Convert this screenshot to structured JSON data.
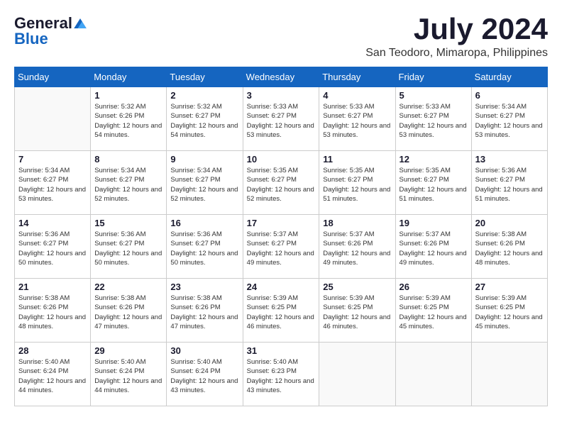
{
  "header": {
    "logo": {
      "general": "General",
      "blue": "Blue"
    },
    "month_title": "July 2024",
    "location": "San Teodoro, Mimaropa, Philippines"
  },
  "weekdays": [
    "Sunday",
    "Monday",
    "Tuesday",
    "Wednesday",
    "Thursday",
    "Friday",
    "Saturday"
  ],
  "weeks": [
    [
      {
        "day": null
      },
      {
        "day": "1",
        "sunrise": "Sunrise: 5:32 AM",
        "sunset": "Sunset: 6:26 PM",
        "daylight": "Daylight: 12 hours and 54 minutes."
      },
      {
        "day": "2",
        "sunrise": "Sunrise: 5:32 AM",
        "sunset": "Sunset: 6:27 PM",
        "daylight": "Daylight: 12 hours and 54 minutes."
      },
      {
        "day": "3",
        "sunrise": "Sunrise: 5:33 AM",
        "sunset": "Sunset: 6:27 PM",
        "daylight": "Daylight: 12 hours and 53 minutes."
      },
      {
        "day": "4",
        "sunrise": "Sunrise: 5:33 AM",
        "sunset": "Sunset: 6:27 PM",
        "daylight": "Daylight: 12 hours and 53 minutes."
      },
      {
        "day": "5",
        "sunrise": "Sunrise: 5:33 AM",
        "sunset": "Sunset: 6:27 PM",
        "daylight": "Daylight: 12 hours and 53 minutes."
      },
      {
        "day": "6",
        "sunrise": "Sunrise: 5:34 AM",
        "sunset": "Sunset: 6:27 PM",
        "daylight": "Daylight: 12 hours and 53 minutes."
      }
    ],
    [
      {
        "day": "7",
        "sunrise": "Sunrise: 5:34 AM",
        "sunset": "Sunset: 6:27 PM",
        "daylight": "Daylight: 12 hours and 53 minutes."
      },
      {
        "day": "8",
        "sunrise": "Sunrise: 5:34 AM",
        "sunset": "Sunset: 6:27 PM",
        "daylight": "Daylight: 12 hours and 52 minutes."
      },
      {
        "day": "9",
        "sunrise": "Sunrise: 5:34 AM",
        "sunset": "Sunset: 6:27 PM",
        "daylight": "Daylight: 12 hours and 52 minutes."
      },
      {
        "day": "10",
        "sunrise": "Sunrise: 5:35 AM",
        "sunset": "Sunset: 6:27 PM",
        "daylight": "Daylight: 12 hours and 52 minutes."
      },
      {
        "day": "11",
        "sunrise": "Sunrise: 5:35 AM",
        "sunset": "Sunset: 6:27 PM",
        "daylight": "Daylight: 12 hours and 51 minutes."
      },
      {
        "day": "12",
        "sunrise": "Sunrise: 5:35 AM",
        "sunset": "Sunset: 6:27 PM",
        "daylight": "Daylight: 12 hours and 51 minutes."
      },
      {
        "day": "13",
        "sunrise": "Sunrise: 5:36 AM",
        "sunset": "Sunset: 6:27 PM",
        "daylight": "Daylight: 12 hours and 51 minutes."
      }
    ],
    [
      {
        "day": "14",
        "sunrise": "Sunrise: 5:36 AM",
        "sunset": "Sunset: 6:27 PM",
        "daylight": "Daylight: 12 hours and 50 minutes."
      },
      {
        "day": "15",
        "sunrise": "Sunrise: 5:36 AM",
        "sunset": "Sunset: 6:27 PM",
        "daylight": "Daylight: 12 hours and 50 minutes."
      },
      {
        "day": "16",
        "sunrise": "Sunrise: 5:36 AM",
        "sunset": "Sunset: 6:27 PM",
        "daylight": "Daylight: 12 hours and 50 minutes."
      },
      {
        "day": "17",
        "sunrise": "Sunrise: 5:37 AM",
        "sunset": "Sunset: 6:27 PM",
        "daylight": "Daylight: 12 hours and 49 minutes."
      },
      {
        "day": "18",
        "sunrise": "Sunrise: 5:37 AM",
        "sunset": "Sunset: 6:26 PM",
        "daylight": "Daylight: 12 hours and 49 minutes."
      },
      {
        "day": "19",
        "sunrise": "Sunrise: 5:37 AM",
        "sunset": "Sunset: 6:26 PM",
        "daylight": "Daylight: 12 hours and 49 minutes."
      },
      {
        "day": "20",
        "sunrise": "Sunrise: 5:38 AM",
        "sunset": "Sunset: 6:26 PM",
        "daylight": "Daylight: 12 hours and 48 minutes."
      }
    ],
    [
      {
        "day": "21",
        "sunrise": "Sunrise: 5:38 AM",
        "sunset": "Sunset: 6:26 PM",
        "daylight": "Daylight: 12 hours and 48 minutes."
      },
      {
        "day": "22",
        "sunrise": "Sunrise: 5:38 AM",
        "sunset": "Sunset: 6:26 PM",
        "daylight": "Daylight: 12 hours and 47 minutes."
      },
      {
        "day": "23",
        "sunrise": "Sunrise: 5:38 AM",
        "sunset": "Sunset: 6:26 PM",
        "daylight": "Daylight: 12 hours and 47 minutes."
      },
      {
        "day": "24",
        "sunrise": "Sunrise: 5:39 AM",
        "sunset": "Sunset: 6:25 PM",
        "daylight": "Daylight: 12 hours and 46 minutes."
      },
      {
        "day": "25",
        "sunrise": "Sunrise: 5:39 AM",
        "sunset": "Sunset: 6:25 PM",
        "daylight": "Daylight: 12 hours and 46 minutes."
      },
      {
        "day": "26",
        "sunrise": "Sunrise: 5:39 AM",
        "sunset": "Sunset: 6:25 PM",
        "daylight": "Daylight: 12 hours and 45 minutes."
      },
      {
        "day": "27",
        "sunrise": "Sunrise: 5:39 AM",
        "sunset": "Sunset: 6:25 PM",
        "daylight": "Daylight: 12 hours and 45 minutes."
      }
    ],
    [
      {
        "day": "28",
        "sunrise": "Sunrise: 5:40 AM",
        "sunset": "Sunset: 6:24 PM",
        "daylight": "Daylight: 12 hours and 44 minutes."
      },
      {
        "day": "29",
        "sunrise": "Sunrise: 5:40 AM",
        "sunset": "Sunset: 6:24 PM",
        "daylight": "Daylight: 12 hours and 44 minutes."
      },
      {
        "day": "30",
        "sunrise": "Sunrise: 5:40 AM",
        "sunset": "Sunset: 6:24 PM",
        "daylight": "Daylight: 12 hours and 43 minutes."
      },
      {
        "day": "31",
        "sunrise": "Sunrise: 5:40 AM",
        "sunset": "Sunset: 6:23 PM",
        "daylight": "Daylight: 12 hours and 43 minutes."
      },
      {
        "day": null
      },
      {
        "day": null
      },
      {
        "day": null
      }
    ]
  ]
}
